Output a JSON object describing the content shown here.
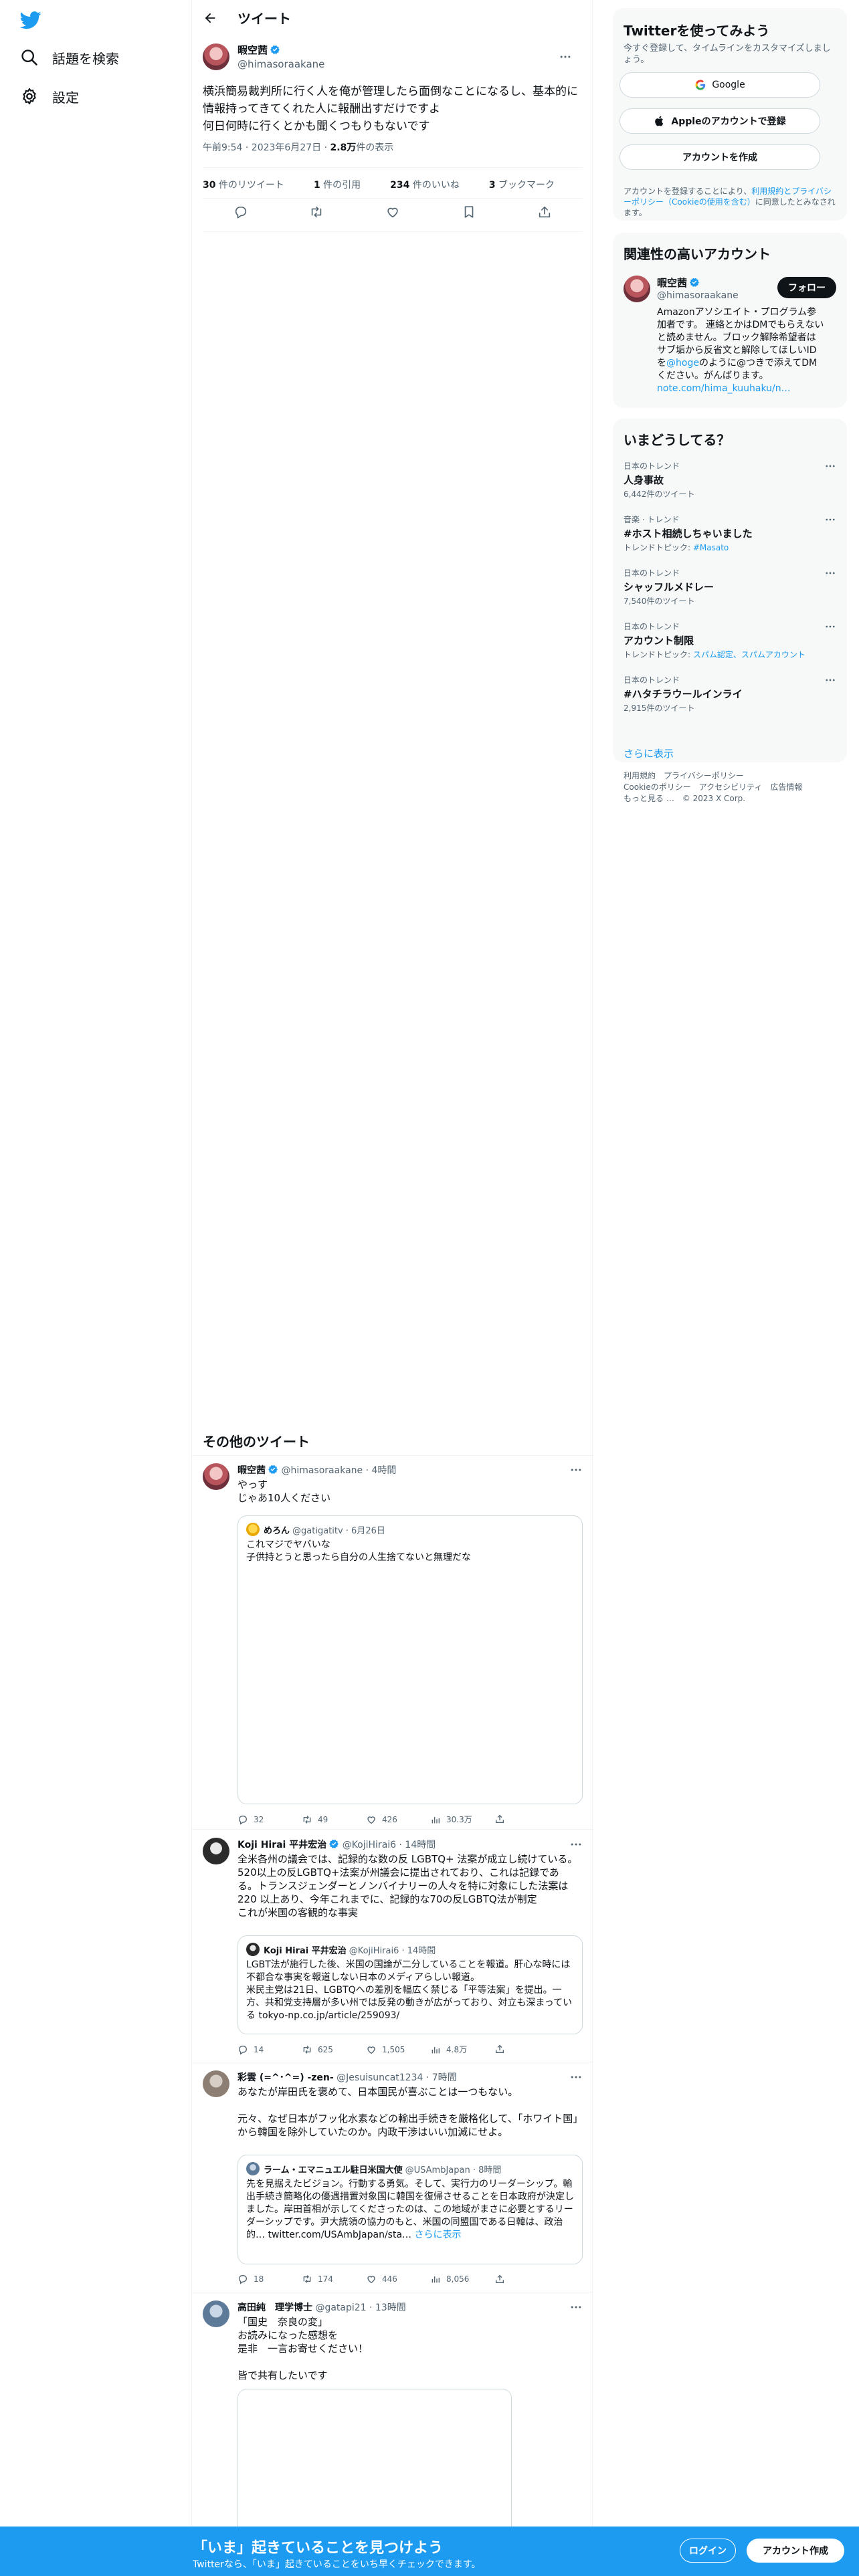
{
  "nav": {
    "explore_label": "話題を検索",
    "settings_label": "設定"
  },
  "header": {
    "title": "ツイート"
  },
  "tweet": {
    "author_name": "暇空茜",
    "author_handle": "@himasoraakane",
    "text": "横浜簡易裁判所に行く人を俺が管理したら面倒なことになるし、基本的に情報持ってきてくれた人に報酬出すだけですよ\n何日何時に行くとかも聞くつもりもないです",
    "time": "午前9:54 · 2023年6月27日 · ",
    "views_count": "2.8万",
    "views_label": "件の表示",
    "retweets_count": "30",
    "retweets_label": "件のリツイート",
    "quotes_count": "1",
    "quotes_label": "件の引用",
    "likes_count": "234",
    "likes_label": "件のいいね",
    "bookmarks_count": "3",
    "bookmarks_label": "ブックマーク"
  },
  "more_tweets": {
    "title": "その他のツイート",
    "items": [
      {
        "name": "暇空茜",
        "handle": "@himasoraakane · 4時間",
        "text": "やっす\nじゃあ10人ください",
        "quote_name": "めろん",
        "quote_handle": "@gatigatitv · 6月26日",
        "quote_text": "これマジでヤバいな\n子供持とうと思ったら自分の人生捨てないと無理だな",
        "replies": "32",
        "retweets": "49",
        "likes": "426",
        "views": "30.3万"
      },
      {
        "name": "Koji Hirai 平井宏治",
        "handle": "@KojiHirai6 · 14時間",
        "text": "全米各州の議会では、記録的な数の反 LGBTQ+ 法案が成立し続けている。520以上の反LGBTQ+法案が州議会に提出されており、これは記録である。トランスジェンダーとノンバイナリーの人々を特に対象にした法案は220 以上あり、今年これまでに、記録的な70の反LGBTQ法が制定\nこれが米国の客観的な事実",
        "quote_name": "Koji Hirai 平井宏治",
        "quote_handle": "@KojiHirai6 · 14時間",
        "quote_text": "LGBT法が施行した後、米国の国論が二分していることを報道。肝心な時には不都合な事実を報道しない日本のメディアらしい報道。\n米民主党は21日、LGBTQへの差別を幅広く禁じる「平等法案」を提出。一方、共和党支持層が多い州では反発の動きが広がっており、対立も深まっている tokyo-np.co.jp/article/259093/",
        "replies": "14",
        "retweets": "625",
        "likes": "1,505",
        "views": "4.8万"
      },
      {
        "name": "彩雲 (=^･^=) -zen-",
        "handle": "@Jesuisuncat1234 · 7時間",
        "text": "あなたが岸田氏を褒めて、日本国民が喜ぶことは一つもない。\n\n元々、なぜ日本がフッ化水素などの輸出手続きを厳格化して、「ホワイト国」から韓国を除外していたのか。内政干渉はいい加減にせよ。",
        "quote_name": "ラーム・エマニュエル駐日米国大使",
        "quote_handle": "@USAmbJapan · 8時間",
        "quote_text": "先を見据えたビジョン。行動する勇気。そして、実行力のリーダーシップ。輸出手続き簡略化の優遇措置対象国に韓国を復帰させることを日本政府が決定しました。岸田首相が示してくださったのは、この地域がまさに必要とするリーダーシップです。尹大統領の協力のもと、米国の同盟国である日韓は、政治的… twitter.com/USAmbJapan/sta…",
        "quote_more": "さらに表示",
        "replies": "18",
        "retweets": "174",
        "likes": "446",
        "views": "8,056"
      },
      {
        "name": "高田純　理学博士",
        "handle": "@gatapi21 · 13時間",
        "text": "「国史　奈良の変」\nお読みになった感想を\n是非　一言お寄せください！\n\n皆で共有したいです"
      }
    ]
  },
  "signup": {
    "title": "Twitterを使ってみよう",
    "subtitle": "今すぐ登録して、タイムラインをカスタマイズしましょう。",
    "google_label": "Google",
    "apple_label": "Appleのアカウントで登録",
    "create_label": "アカウントを作成",
    "legal_prefix": "アカウントを登録することにより、",
    "legal_link": "利用規約とプライバシーポリシー（Cookieの使用を含む）",
    "legal_suffix": "に同意したとみなされます。"
  },
  "related": {
    "title": "関連性の高いアカウント",
    "name": "暇空茜",
    "handle": "@himasoraakane",
    "bio": "Amazonアソシエイト・プログラム参加者です。 連絡とかはDMでもらえないと読めません。ブロック解除希望者はサブ垢から反省文と解除してほしいIDを",
    "bio_link": "@hoge",
    "bio_rest": "のように@つきで添えてDMください。がんばります。",
    "bio_url": "note.com/hima_kuuhaku/n…",
    "follow_label": "フォロー"
  },
  "trends": {
    "title": "いまどうしてる？",
    "items": [
      {
        "context": "日本のトレンド",
        "name": "人身事故",
        "count": "6,442件のツイート"
      },
      {
        "context": "音楽 · トレンド",
        "name": "#ホスト相続しちゃいました",
        "count_prefix": "トレンドトピック: ",
        "count_link": "#Masato"
      },
      {
        "context": "日本のトレンド",
        "name": "シャッフルメドレー",
        "count": "7,540件のツイート"
      },
      {
        "context": "日本のトレンド",
        "name": "アカウント制限",
        "count_prefix": "トレンドトピック: ",
        "count_link": "スパム認定、スパムアカウント"
      },
      {
        "context": "日本のトレンド",
        "name": "#ハタチラウールインライ",
        "count": "2,915件のツイート"
      }
    ],
    "show_more": "さらに表示"
  },
  "footer": {
    "links": [
      "利用規約",
      "プライバシーポリシー",
      "Cookieのポリシー",
      "アクセシビリティ",
      "広告情報",
      "もっと見る …",
      "© 2023 X Corp."
    ]
  },
  "bottombar": {
    "title": "「いま」起きていることを見つけよう",
    "subtitle": "Twitterなら、「いま」起きていることをいち早くチェックできます。",
    "login_label": "ログイン",
    "create_label": "アカウント作成"
  },
  "colors": {
    "accent": "#1d9bf0",
    "text": "#0f1419",
    "muted": "#536471"
  }
}
